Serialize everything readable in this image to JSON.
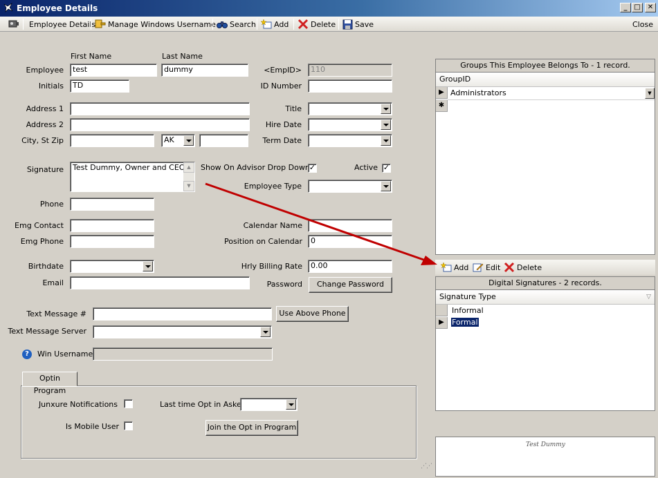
{
  "window": {
    "title": "Employee Details",
    "minimize": "_",
    "maximize": "□",
    "close": "✕"
  },
  "toolbar": {
    "employee_details": "Employee Details",
    "manage_windows_username": "Manage Windows Username",
    "search": "Search",
    "add": "Add",
    "delete": "Delete",
    "save": "Save",
    "close": "Close"
  },
  "form": {
    "first_name_header": "First Name",
    "last_name_header": "Last Name",
    "employee_label": "Employee",
    "first_name": "test",
    "last_name": "dummy",
    "empid_label": "<EmpID>",
    "empid": "110",
    "initials_label": "Initials",
    "initials": "TD",
    "id_number_label": "ID Number",
    "id_number": "",
    "address1_label": "Address 1",
    "address1": "",
    "address2_label": "Address 2",
    "address2": "",
    "city_st_zip_label": "City, St Zip",
    "city": "",
    "state": "AK",
    "zip": "",
    "title_label": "Title",
    "title": "",
    "hire_date_label": "Hire Date",
    "hire_date": "",
    "term_date_label": "Term Date",
    "term_date": "",
    "signature_label": "Signature",
    "signature": "Test Dummy, Owner and CEO",
    "show_on_advisor_label": "Show On Advisor Drop Down",
    "show_on_advisor": "✓",
    "active_label": "Active",
    "active": "✓",
    "employee_type_label": "Employee Type",
    "employee_type": "",
    "phone_label": "Phone",
    "phone": "",
    "emg_contact_label": "Emg Contact",
    "emg_contact": "",
    "emg_phone_label": "Emg Phone",
    "emg_phone": "",
    "calendar_name_label": "Calendar Name",
    "calendar_name": "",
    "position_on_calendar_label": "Position on Calendar",
    "position_on_calendar": "0",
    "birthdate_label": "Birthdate",
    "birthdate": "",
    "hrly_billing_rate_label": "Hrly Billing Rate",
    "hrly_billing_rate": "0.00",
    "email_label": "Email",
    "email": "",
    "password_label": "Password",
    "change_password_button": "Change Password",
    "text_message_label": "Text Message #",
    "text_message": "",
    "use_above_phone_button": "Use Above Phone",
    "text_message_server_label": "Text Message Server",
    "text_message_server": "",
    "win_username_label": "Win Username",
    "win_username": ""
  },
  "optin": {
    "tab_label": "Optin Program",
    "junxure_notifications_label": "Junxure Notifications",
    "junxure_notifications": "",
    "last_time_opt_in_label": "Last time Opt in Asked",
    "last_time_opt_in": "",
    "is_mobile_user_label": "Is Mobile User",
    "is_mobile_user": "",
    "join_button": "Join the Opt in Program"
  },
  "groups": {
    "header": "Groups This Employee Belongs To - 1 record.",
    "column": "GroupID",
    "rows": [
      "Administrators"
    ],
    "new_row_marker": "✱"
  },
  "signatures": {
    "add": "Add",
    "edit": "Edit",
    "delete": "Delete",
    "header": "Digital Signatures - 2 records.",
    "column": "Signature Type",
    "rows": [
      "Informal",
      "Formal"
    ]
  },
  "signature_preview": {
    "text": "Test Dummy"
  },
  "colors": {
    "title_bar": "#0a246a",
    "annotation_arrow": "#c00000",
    "selection": "#0a246a"
  }
}
